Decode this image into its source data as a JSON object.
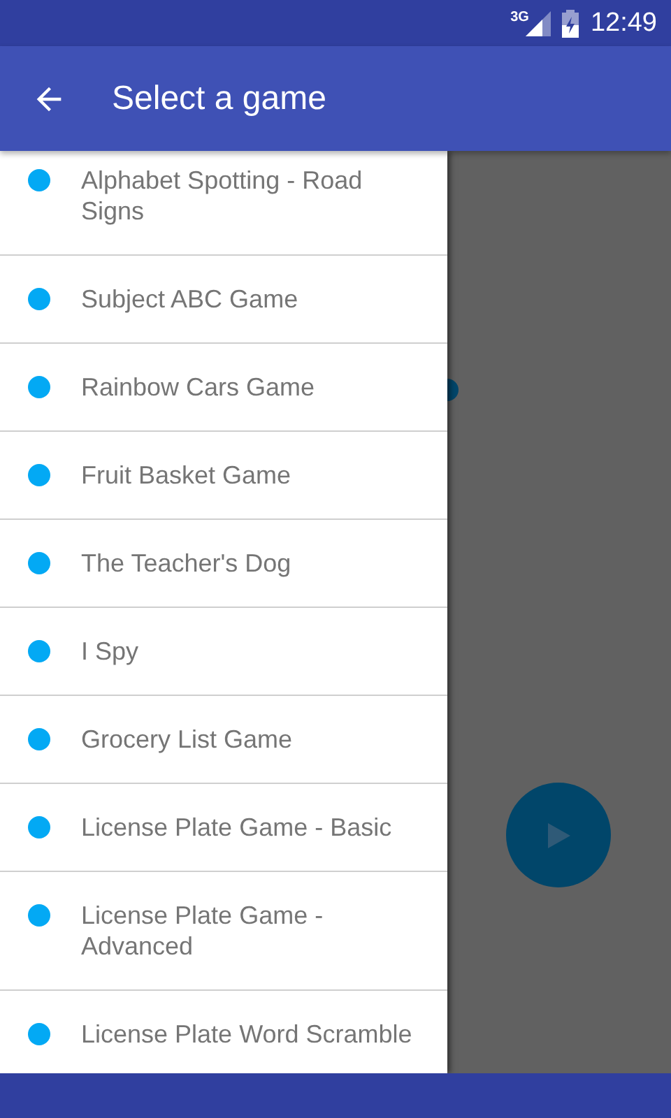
{
  "status_bar": {
    "network": "3G",
    "time": "12:49"
  },
  "app_bar": {
    "title": "Select a game"
  },
  "games": [
    {
      "name": "Alphabet Spotting - Road Signs"
    },
    {
      "name": "Subject ABC Game"
    },
    {
      "name": "Rainbow Cars Game"
    },
    {
      "name": "Fruit Basket Game"
    },
    {
      "name": "The Teacher's Dog"
    },
    {
      "name": "I Spy"
    },
    {
      "name": "Grocery List Game"
    },
    {
      "name": "License Plate Game - Basic"
    },
    {
      "name": "License Plate Game - Advanced"
    },
    {
      "name": "License Plate Word Scramble"
    }
  ]
}
